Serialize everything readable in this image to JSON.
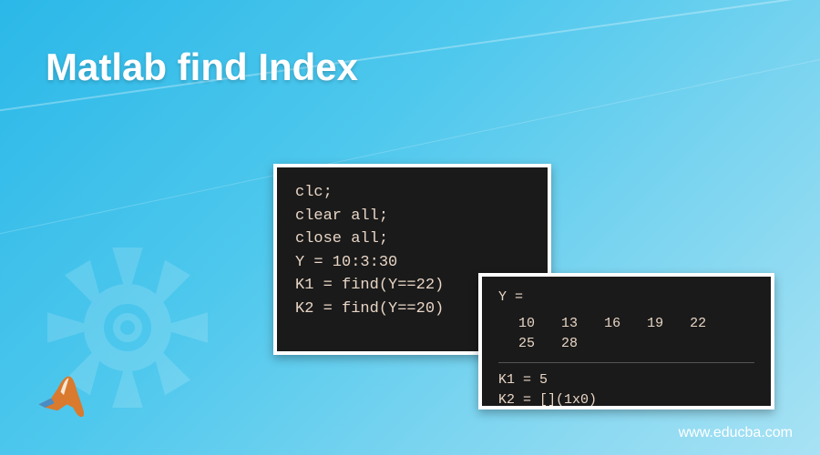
{
  "title": "Matlab find Index",
  "code1": {
    "l1": "clc;",
    "l2": "clear all;",
    "l3": "close all;",
    "l4": "Y = 10:3:30",
    "l5": "K1 = find(Y==22)",
    "l6": "K2 = find(Y==20)"
  },
  "code2": {
    "label_y": "Y =",
    "values": [
      "10",
      "13",
      "16",
      "19",
      "22",
      "25",
      "28"
    ],
    "k1": "K1 = 5",
    "k2": "K2 = [](1x0)"
  },
  "footer": "www.educba.com",
  "icons": {
    "matlab": "matlab-logo",
    "gear": "gear-icon"
  }
}
